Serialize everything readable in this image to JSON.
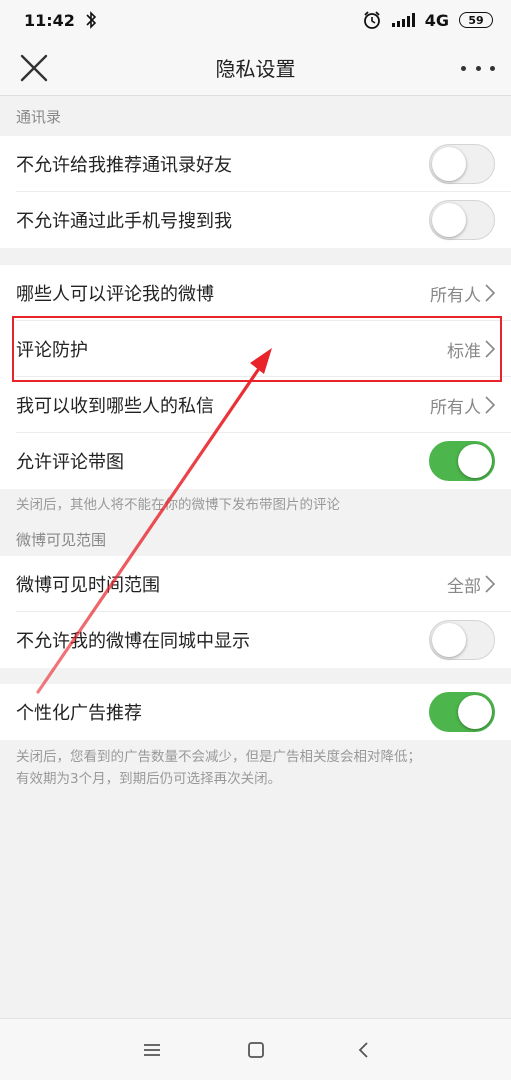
{
  "status_bar": {
    "time": "11:42",
    "network": "4G",
    "battery": "59",
    "icons": [
      "bluetooth-icon",
      "alarm-icon",
      "signal-icon"
    ]
  },
  "nav": {
    "title": "隐私设置",
    "close_icon": "close-icon",
    "more_icon": "more-icon"
  },
  "sections": {
    "contacts_header": "通讯录",
    "visibility_header": "微博可见范围"
  },
  "rows": {
    "no_recommend_contacts": {
      "label": "不允许给我推荐通讯录好友",
      "on": false
    },
    "no_search_by_phone": {
      "label": "不允许通过此手机号搜到我",
      "on": false
    },
    "who_can_comment": {
      "label": "哪些人可以评论我的微博",
      "value": "所有人"
    },
    "comment_protection": {
      "label": "评论防护",
      "value": "标准"
    },
    "who_can_message": {
      "label": "我可以收到哪些人的私信",
      "value": "所有人"
    },
    "allow_comment_images": {
      "label": "允许评论带图",
      "on": true
    },
    "visible_time_range": {
      "label": "微博可见时间范围",
      "value": "全部"
    },
    "no_same_city": {
      "label": "不允许我的微博在同城中显示",
      "on": false
    },
    "personalized_ads": {
      "label": "个性化广告推荐",
      "on": true
    }
  },
  "notes": {
    "comment_images_note": "关闭后，其他人将不能在你的微博下发布带图片的评论",
    "ads_note_line1": "关闭后，您看到的广告数量不会减少，但是广告相关度会相对降低；",
    "ads_note_line2": "有效期为3个月，到期后仍可选择再次关闭。"
  },
  "colors": {
    "toggle_on": "#4cb54b",
    "annotation_red": "#e8242a"
  },
  "bottom_nav": {
    "icons": [
      "menu-icon",
      "home-icon",
      "back-icon"
    ]
  }
}
